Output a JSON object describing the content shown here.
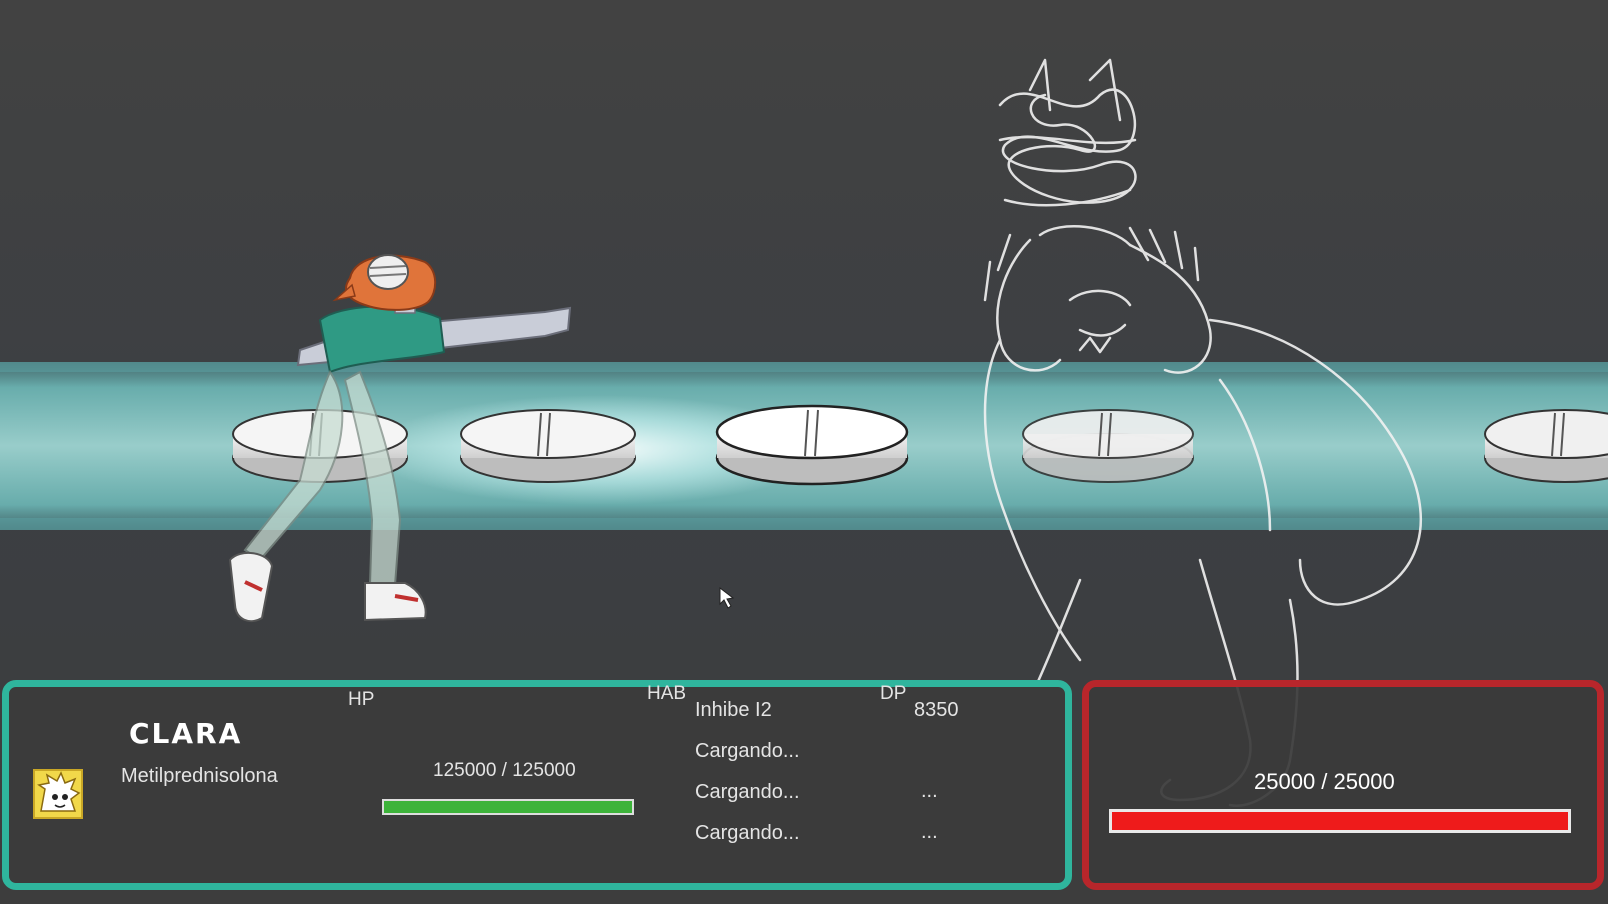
{
  "player": {
    "name": "CLARA",
    "subtitle": "Metilprednisolona",
    "hp_label": "HP",
    "hp_text": "125000 / 125000",
    "hp_fraction": 1.0,
    "hab_label": "HAB",
    "dp_label": "DP",
    "abilities": [
      {
        "name": "Inhibe I2",
        "dp": "8350"
      },
      {
        "name": "Cargando...",
        "dp": "..."
      },
      {
        "name": "Cargando...",
        "dp": "..."
      }
    ],
    "portrait_icon": "hedgehog-portrait-icon"
  },
  "enemy": {
    "hp_text": "25000 / 25000",
    "hp_fraction": 1.0
  },
  "colors": {
    "player_border": "#2fb59d",
    "enemy_border": "#b8262b",
    "player_hp": "#3db33a",
    "enemy_hp": "#ee1b1b",
    "beam": "#7fd9d6"
  }
}
